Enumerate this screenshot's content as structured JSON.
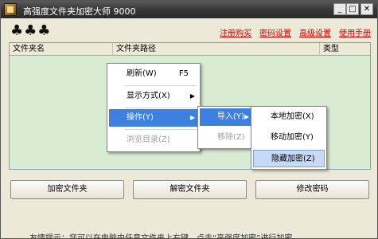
{
  "window": {
    "title": "高强度文件夹加密大师 9000",
    "min_label": "_",
    "max_label": "□",
    "close_label": "✕"
  },
  "toolbar": {
    "suits": "♣♣♣",
    "links": [
      "注册购买",
      "密码设置",
      "高级设置",
      "使用手册"
    ]
  },
  "list": {
    "columns": [
      "文件夹名",
      "文件夹路径",
      "类型"
    ]
  },
  "context_menu": {
    "items": [
      {
        "label": "刷新(W)",
        "shortcut": "F5"
      },
      {
        "label": "显示方式(X)",
        "submenu": "▶"
      },
      {
        "label": "操作(Y)",
        "submenu": "▶"
      },
      {
        "label": "浏览目录(Z)"
      }
    ]
  },
  "submenu1": {
    "items": [
      {
        "label": "导入(Y)",
        "submenu": "▶"
      },
      {
        "label": "移除(Z)"
      }
    ]
  },
  "submenu2": {
    "items": [
      {
        "label": "本地加密(X)"
      },
      {
        "label": "移动加密(Y)"
      },
      {
        "label": "隐藏加密(Z)"
      }
    ]
  },
  "buttons": {
    "encrypt": "加密文件夹",
    "decrypt": "解密文件夹",
    "change_password": "修改密码"
  },
  "tip": "友情提示：您可以在电脑中任意文件夹上右键，点击“高强度加密”进行加密。"
}
